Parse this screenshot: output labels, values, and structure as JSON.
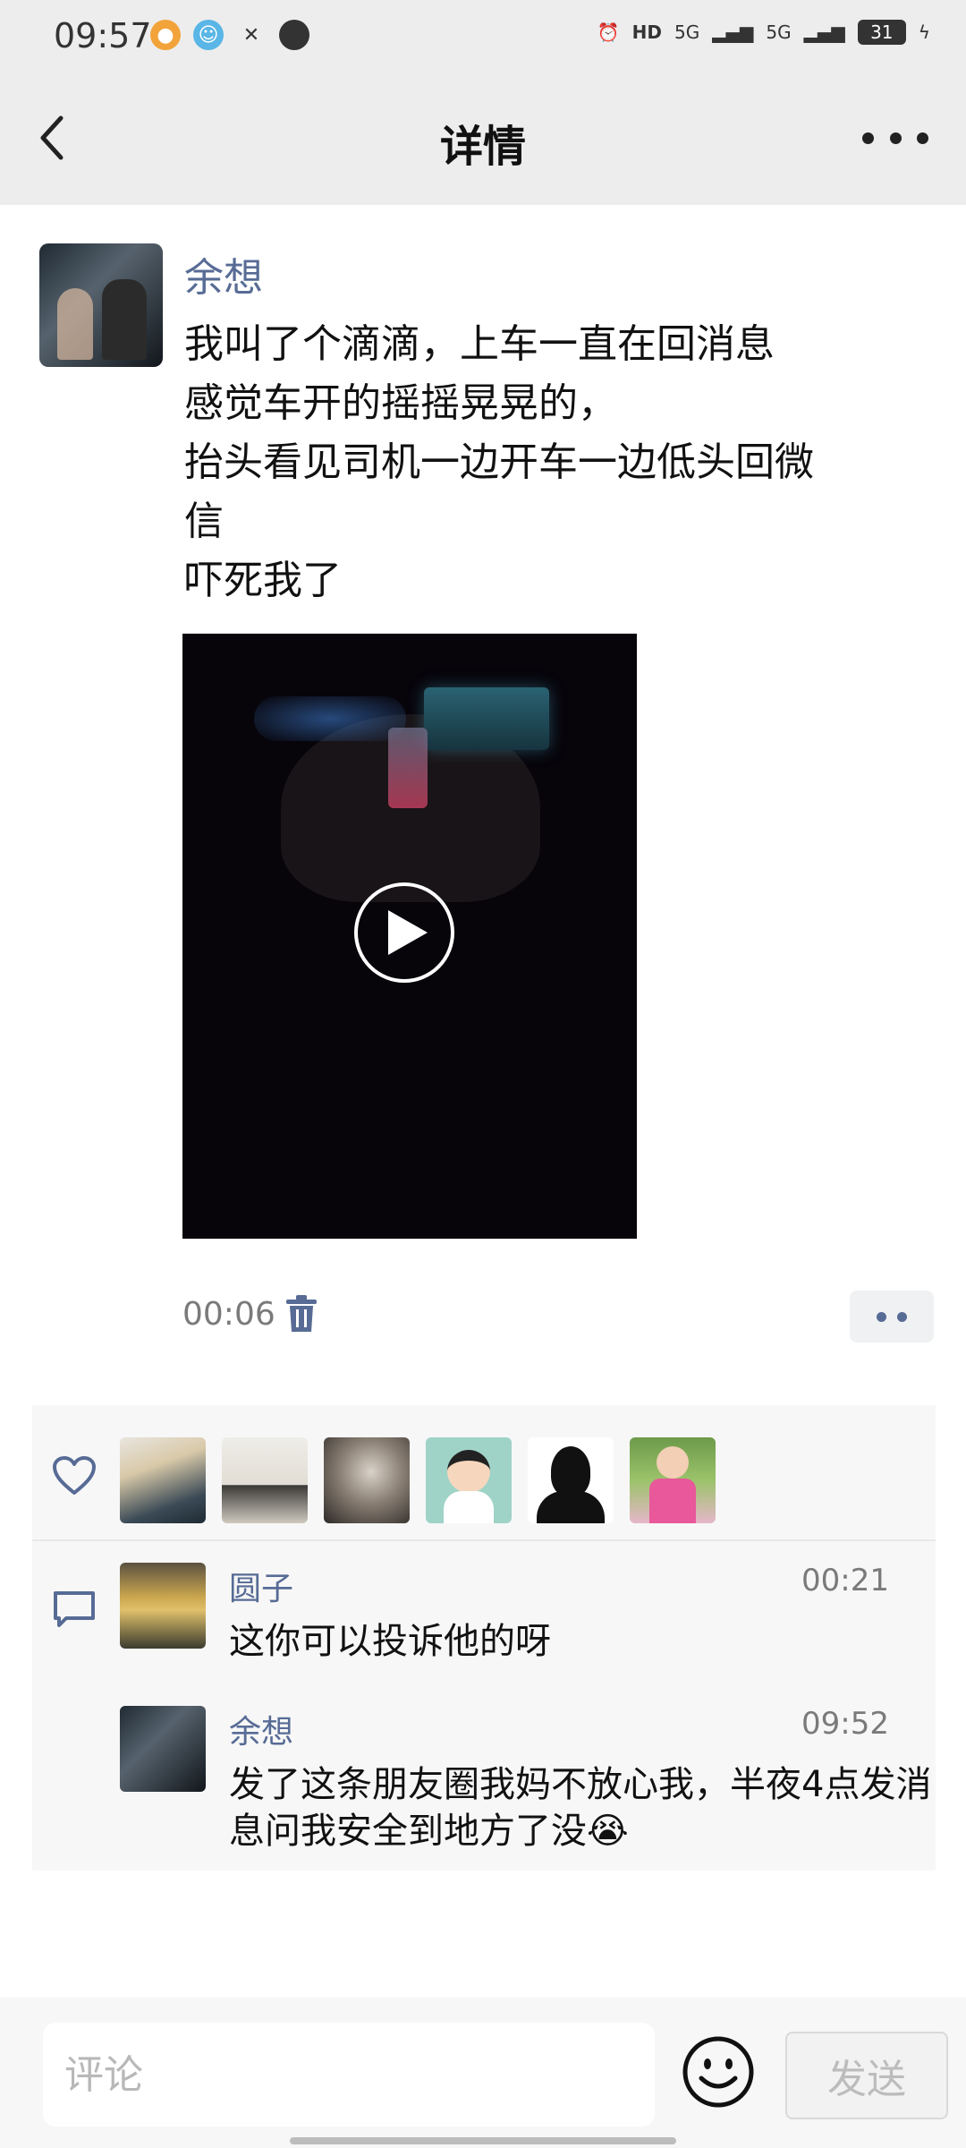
{
  "status_bar": {
    "time": "09:57",
    "icons": [
      "weibo-icon",
      "qq-icon",
      "tools-icon",
      "chat-icon"
    ],
    "right": {
      "hd": "HD",
      "signal1": "5G",
      "signal2": "5G",
      "battery": "31"
    }
  },
  "header": {
    "title": "详情"
  },
  "post": {
    "author": "余想",
    "lines": [
      "我叫了个滴滴，上车一直在回消息",
      "感觉车开的摇摇晃晃的，",
      "抬头看见司机一边开车一边低头回微",
      "信",
      "吓死我了"
    ],
    "time": "00:06"
  },
  "likes": {
    "avatars": [
      "avatar-1",
      "avatar-2",
      "avatar-3",
      "avatar-4",
      "avatar-5",
      "avatar-6"
    ]
  },
  "comments": [
    {
      "name": "圆子",
      "time": "00:21",
      "text": "这你可以投诉他的呀"
    },
    {
      "name": "余想",
      "time": "09:52",
      "text": "发了这条朋友圈我妈不放心我，半夜4点发消息问我安全到地方了没😭"
    }
  ],
  "input": {
    "placeholder": "评论",
    "send_label": "发送"
  },
  "colors": {
    "link": "#576b95",
    "header_bg": "#ededed",
    "panel_bg": "#f7f7f7"
  }
}
